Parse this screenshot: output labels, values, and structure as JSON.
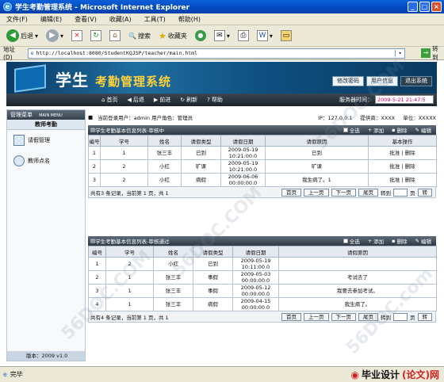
{
  "window": {
    "title": "学生考勤管理系统 - Microsoft Internet Explorer"
  },
  "menu": [
    "文件(F)",
    "编辑(E)",
    "查看(V)",
    "收藏(A)",
    "工具(T)",
    "帮助(H)"
  ],
  "toolbar": {
    "back": "后退",
    "search": "搜索",
    "favorites": "收藏夹"
  },
  "address": {
    "label": "地址(D)",
    "url": "http://localhost:8080/StudentKQJSP/teacher/main.html",
    "go": "转到"
  },
  "banner": {
    "title_big": "学生",
    "title_small": "考勤管理系统",
    "btn_password": "修改密码",
    "btn_userinfo": "用户信息",
    "btn_exit": "退出系统"
  },
  "nav": {
    "home": "首页",
    "back": "后退",
    "forward": "前进",
    "refresh": "刷新",
    "help": "帮助",
    "time_label": "服务器时间：",
    "time_value": "2009-5-21 21:47:5"
  },
  "sidebar": {
    "header": "管理菜单",
    "header_en": "MAIN MENU",
    "section": "教师考勤",
    "items": [
      "请假管理",
      "教师点名"
    ],
    "footer": "版本：2009 v1.0"
  },
  "info": {
    "user": "当前登录用户：admin  用户角色：管理员",
    "ip": "IP：127.0.0.1",
    "provider": "提供商：XXXX",
    "unit": "单位：XXXXX"
  },
  "panel1": {
    "title": "学生考勤基本信息列表-审核中",
    "actions": [
      "全选",
      "添加",
      "删除",
      "编辑"
    ],
    "columns": [
      "编号",
      "学号",
      "姓名",
      "请假类型",
      "请假日期",
      "请假原因",
      "基本操作"
    ],
    "rows": [
      [
        "1",
        "1",
        "张三丰",
        "已到",
        "2009-05-19\n10:21:00.0",
        "已到",
        "批准 | 删除"
      ],
      [
        "2",
        "2",
        "小红",
        "旷课",
        "2009-05-19\n10:21:00.0",
        "旷课",
        "批准 | 删除"
      ],
      [
        "3",
        "2",
        "小红",
        "病假",
        "2009-06-06\n00:00:00.0",
        "我生病了。1",
        "批准 | 删除"
      ]
    ],
    "pager": {
      "text": "共有3 条记录，当前第 1 页，共 1",
      "buttons": [
        "首页",
        "上一页",
        "下一页",
        "尾页"
      ],
      "goto": "转到",
      "page": "页",
      "go": "转"
    }
  },
  "panel2": {
    "title": "学生考勤基本信息列表-审核通过",
    "actions": [
      "全选",
      "添加",
      "删除",
      "编辑"
    ],
    "columns": [
      "编号",
      "学号",
      "姓名",
      "请假类型",
      "请假日期",
      "请假原因"
    ],
    "rows": [
      [
        "1",
        "2",
        "小红",
        "已到",
        "2009-05-19\n10:11:00.0",
        ""
      ],
      [
        "2",
        "1",
        "张三丰",
        "事假",
        "2009-05-03\n00:00:00.0",
        "考试去了"
      ],
      [
        "3",
        "1",
        "张三丰",
        "事假",
        "2009-05-12\n00:00:00.0",
        "我要去参加考试。"
      ],
      [
        "4",
        "1",
        "张三丰",
        "病假",
        "2009-04-15\n00:00:00.0",
        "我生病了。"
      ]
    ],
    "pager": {
      "text": "共有4 条记录，当前第 1 页，共 1",
      "buttons": [
        "首页",
        "上一页",
        "下一页",
        "尾页"
      ],
      "goto": "转到",
      "page": "页",
      "go": "转"
    }
  },
  "status": {
    "text": "完毕",
    "logo_a": "毕业设计",
    "logo_b": "(论文)网",
    "site": "56DOC.com"
  }
}
